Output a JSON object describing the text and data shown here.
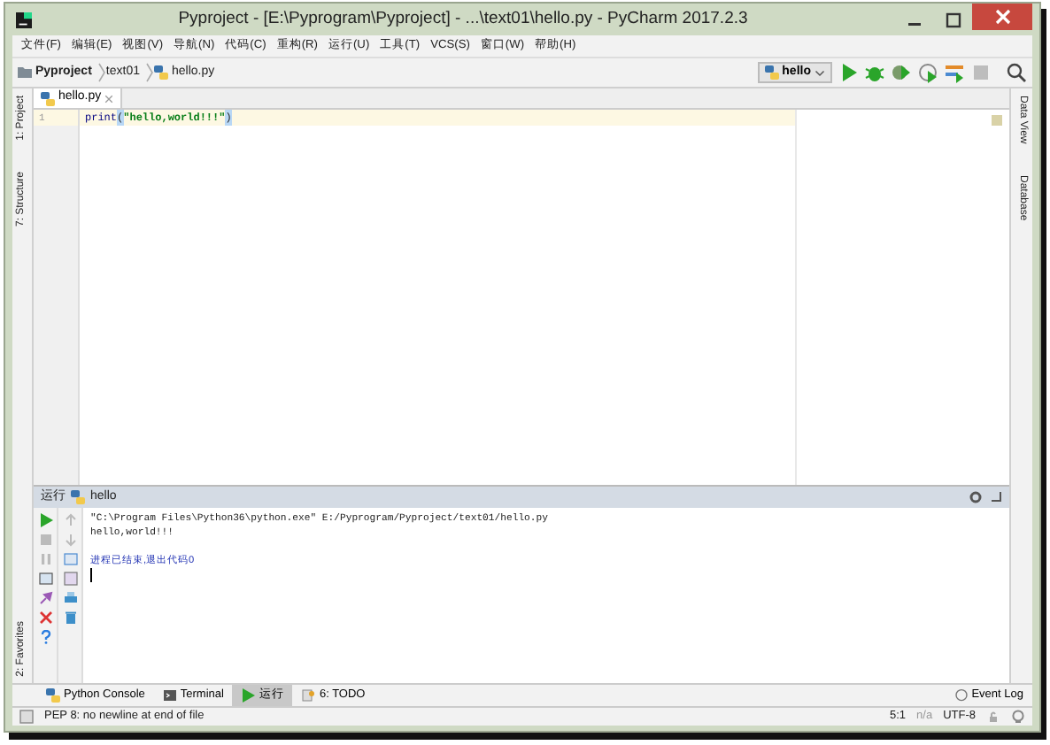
{
  "window": {
    "title": "Pyproject - [E:\\Pyprogram\\Pyproject] - ...\\text01\\hello.py - PyCharm 2017.2.3"
  },
  "menu": [
    "文件(F)",
    "编辑(E)",
    "视图(V)",
    "导航(N)",
    "代码(C)",
    "重构(R)",
    "运行(U)",
    "工具(T)",
    "VCS(S)",
    "窗口(W)",
    "帮助(H)"
  ],
  "breadcrumb": [
    {
      "kind": "project",
      "label": "Pyproject"
    },
    {
      "kind": "folder",
      "label": "text01"
    },
    {
      "kind": "file",
      "label": "hello.py"
    }
  ],
  "run_config": "hello",
  "left_tool_tabs": [
    {
      "label": "1: Project"
    },
    {
      "label": "7: Structure"
    },
    {
      "label": "2: Favorites"
    }
  ],
  "right_tool_tabs": [
    {
      "label": "Data View"
    },
    {
      "label": "Database"
    }
  ],
  "editor": {
    "tabs": [
      {
        "label": "hello.py",
        "selected": true
      }
    ],
    "lines": [
      {
        "number": "1",
        "tokens": [
          {
            "kind": "builtin",
            "text": "print"
          },
          {
            "kind": "paren",
            "text": "("
          },
          {
            "kind": "string",
            "text": "\"hello,world!!!\""
          },
          {
            "kind": "paren",
            "text": ")"
          }
        ]
      }
    ]
  },
  "run_panel": {
    "title": "运行",
    "config": "hello",
    "output": [
      {
        "kind": "command",
        "text": "\"C:\\Program Files\\Python36\\python.exe\" E:/Pyprogram/Pyproject/text01/hello.py"
      },
      {
        "kind": "stdout",
        "text": "hello,world!!!"
      },
      {
        "kind": "exit",
        "text": "进程已结束,退出代码0"
      }
    ]
  },
  "bottom_tabs": [
    {
      "kind": "python",
      "label": "Python Console",
      "selected": false
    },
    {
      "kind": "terminal",
      "label": "Terminal",
      "selected": false
    },
    {
      "kind": "run",
      "label": "运行",
      "selected": true
    },
    {
      "kind": "todo",
      "label": "6: TODO",
      "selected": false
    }
  ],
  "event_log": "Event Log",
  "status_bar": {
    "message": "PEP 8: no newline at end of file",
    "position": "5:1",
    "vcs": "n/a",
    "encoding": "UTF-8"
  }
}
